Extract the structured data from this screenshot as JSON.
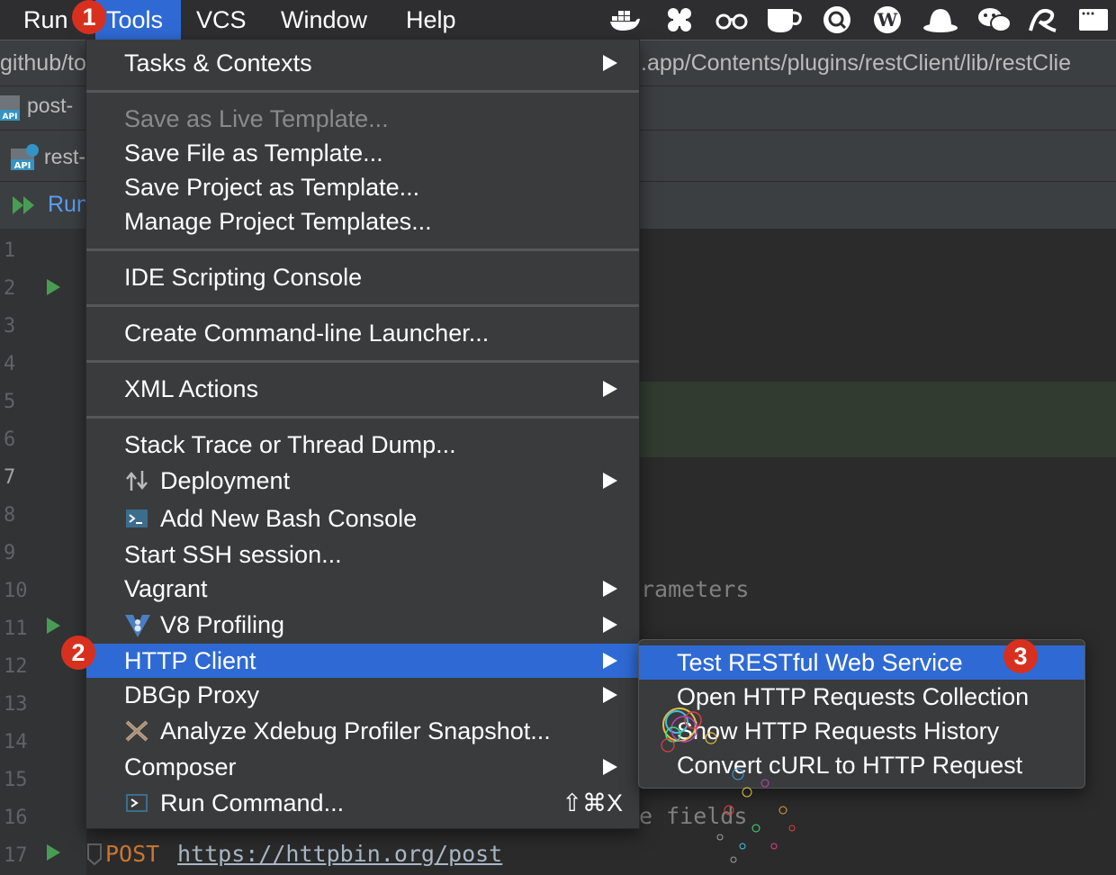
{
  "menubar": {
    "items": [
      "Run",
      "Tools",
      "VCS",
      "Window",
      "Help"
    ],
    "active": "Tools"
  },
  "background": {
    "path_left": "github/to",
    "path_right": ".app/Contents/plugins/restClient/lib/restClie",
    "tab1": "post-",
    "tab2": "rest-",
    "run_label": "Run",
    "line_numbers": [
      "1",
      "2",
      "3",
      "4",
      "5",
      "6",
      "7",
      "8",
      "9",
      "10",
      "11",
      "12",
      "13",
      "14",
      "15",
      "16",
      "17"
    ],
    "current_line": "7",
    "code_fragment_10": "rameters",
    "code_fragment_16": "e fields",
    "code_line_17_method": "POST",
    "code_line_17_url": "https://httpbin.org/post"
  },
  "tools_menu": {
    "tasks_contexts": "Tasks & Contexts",
    "save_live_template": "Save as Live Template...",
    "save_file_template": "Save File as Template...",
    "save_project_template": "Save Project as Template...",
    "manage_project_templates": "Manage Project Templates...",
    "ide_scripting_console": "IDE Scripting Console",
    "create_cli_launcher": "Create Command-line Launcher...",
    "xml_actions": "XML Actions",
    "stack_trace": "Stack Trace or Thread Dump...",
    "deployment": "Deployment",
    "add_bash_console": "Add New Bash Console",
    "start_ssh": "Start SSH session...",
    "vagrant": "Vagrant",
    "v8_profiling": "V8 Profiling",
    "http_client": "HTTP Client",
    "dbgp_proxy": "DBGp Proxy",
    "analyze_xdebug": "Analyze Xdebug Profiler Snapshot...",
    "composer": "Composer",
    "run_command": "Run Command...",
    "run_command_shortcut": "⇧⌘X"
  },
  "http_submenu": {
    "test_restful": "Test RESTful Web Service",
    "open_collection": "Open HTTP Requests Collection",
    "show_history": "Show HTTP Requests History",
    "convert_curl": "Convert cURL to HTTP Request"
  },
  "badges": [
    "1",
    "2",
    "3"
  ],
  "colors": {
    "selection": "#2f6ad4",
    "badge": "#d8301f",
    "menu_bg": "#3a3b3d"
  }
}
